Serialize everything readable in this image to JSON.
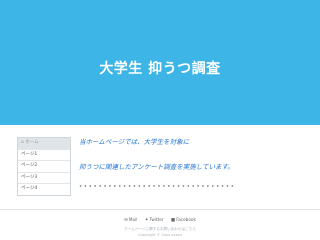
{
  "header": {
    "title": "大学生 抑うつ調査",
    "bg_color": "#3db5e6"
  },
  "sidebar": {
    "items": [
      {
        "label": "ホーム",
        "icon": "home-icon",
        "active": true
      },
      {
        "label": "ページ1"
      },
      {
        "label": "ページ2"
      },
      {
        "label": "ページ3"
      },
      {
        "label": "ページ4"
      }
    ]
  },
  "main": {
    "para1": "当ホームページでは、大学生を対象に",
    "para2": "抑うつに関連したアンケート調査を実施しています。",
    "dots": "••••••••••••••••••••••••••••••••",
    "text_color": "#1e6fd0"
  },
  "footer": {
    "links": [
      {
        "label": "Mail",
        "icon": "mail-icon"
      },
      {
        "label": "Twitter",
        "icon": "twitter-icon"
      },
      {
        "label": "Facebook",
        "icon": "facebook-icon"
      }
    ],
    "note": "ホームページに関するお問い合わせはこちら",
    "copyright": "Copyright © 20xx xxxxx"
  }
}
